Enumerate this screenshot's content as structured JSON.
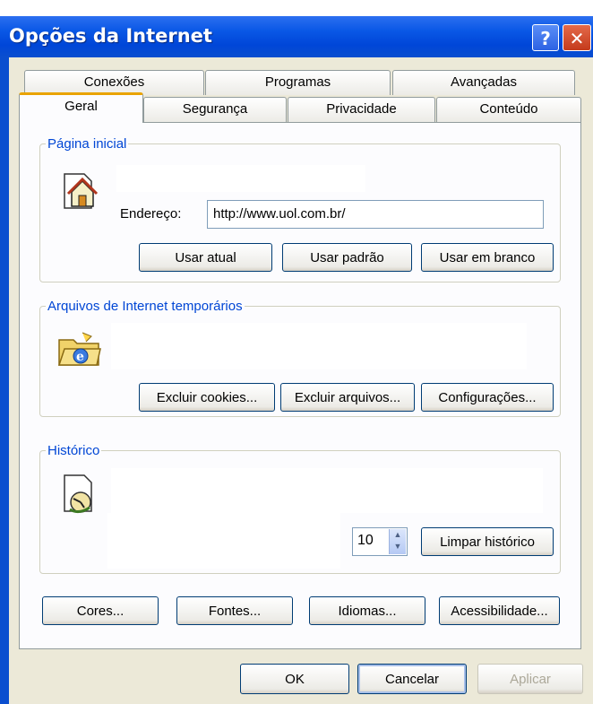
{
  "window": {
    "title": "Opções da Internet",
    "help_glyph": "?",
    "close_glyph": "✕"
  },
  "tabs_row1": [
    {
      "label": "Conexões"
    },
    {
      "label": "Programas"
    },
    {
      "label": "Avançadas"
    }
  ],
  "tabs_row2": [
    {
      "label": "Geral"
    },
    {
      "label": "Segurança"
    },
    {
      "label": "Privacidade"
    },
    {
      "label": "Conteúdo"
    }
  ],
  "active_tab": "Geral",
  "home": {
    "legend": "Página inicial",
    "address_label": "Endereço:",
    "address_value": "http://www.uol.com.br/",
    "icon": "home-page-icon",
    "buttons": {
      "use_current": "Usar atual",
      "use_default": "Usar padrão",
      "use_blank": "Usar em branco"
    }
  },
  "temp_files": {
    "legend": "Arquivos de Internet temporários",
    "icon": "ie-folder-icon",
    "buttons": {
      "delete_cookies": "Excluir cookies...",
      "delete_files": "Excluir arquivos...",
      "settings": "Configurações..."
    }
  },
  "history": {
    "legend": "Histórico",
    "icon": "history-clock-icon",
    "days_value": "10",
    "clear_button": "Limpar histórico"
  },
  "bottom_buttons": {
    "colors": "Cores...",
    "fonts": "Fontes...",
    "languages": "Idiomas...",
    "accessibility": "Acessibilidade..."
  },
  "dialog_buttons": {
    "ok": "OK",
    "cancel": "Cancelar",
    "apply": "Aplicar"
  },
  "colors": {
    "titlebar": "#0a4ecf",
    "dialog_bg": "#ece9d8",
    "group_legend": "#0046d5",
    "active_tab_accent": "#e9a300"
  }
}
